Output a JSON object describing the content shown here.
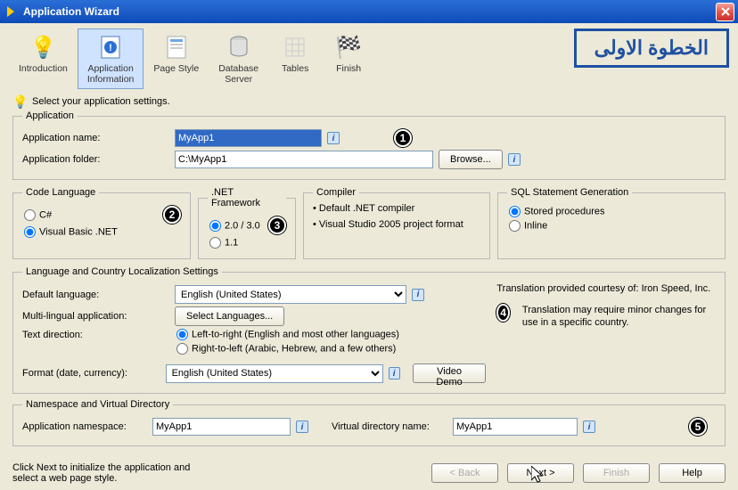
{
  "window": {
    "title": "Application Wizard"
  },
  "toolbar": {
    "items": [
      {
        "label": "Introduction"
      },
      {
        "label": "Application\nInformation"
      },
      {
        "label": "Page Style"
      },
      {
        "label": "Database\nServer"
      },
      {
        "label": "Tables"
      },
      {
        "label": "Finish"
      }
    ]
  },
  "annotation_overlay": "الخطوة الاولى",
  "instruction": "Select your application settings.",
  "application": {
    "legend": "Application",
    "name_label": "Application name:",
    "name_value": "MyApp1",
    "folder_label": "Application folder:",
    "folder_value": "C:\\MyApp1",
    "browse": "Browse..."
  },
  "code_language": {
    "legend": "Code Language",
    "csharp": "C#",
    "vbnet": "Visual Basic .NET"
  },
  "net_framework": {
    "legend": ".NET Framework",
    "v20": "2.0 / 3.0",
    "v11": "1.1"
  },
  "compiler": {
    "legend": "Compiler",
    "line1": "Default .NET compiler",
    "line2": "Visual Studio 2005 project format"
  },
  "sql": {
    "legend": "SQL Statement Generation",
    "stored": "Stored procedures",
    "inline": "Inline"
  },
  "localization": {
    "legend": "Language and Country Localization Settings",
    "default_lang_label": "Default language:",
    "default_lang_value": "English (United States)",
    "multi_label": "Multi-lingual application:",
    "select_languages": "Select Languages...",
    "text_direction_label": "Text direction:",
    "ltr": "Left-to-right (English and most other languages)",
    "rtl": "Right-to-left (Arabic, Hebrew, and a few others)",
    "format_label": "Format (date, currency):",
    "format_value": "English (United States)",
    "video_demo": "Video Demo",
    "trans1": "Translation provided courtesy of: Iron Speed, Inc.",
    "trans2": "Translation may require minor changes for use in a specific country."
  },
  "namespace": {
    "legend": "Namespace and Virtual Directory",
    "ns_label": "Application namespace:",
    "ns_value": "MyApp1",
    "vd_label": "Virtual directory name:",
    "vd_value": "MyApp1"
  },
  "footer": {
    "hint": "Click Next to initialize the application and select a web page style.",
    "back": "< Back",
    "next": "Next >",
    "finish": "Finish",
    "help": "Help"
  },
  "badges": [
    "1",
    "2",
    "3",
    "4",
    "5"
  ]
}
